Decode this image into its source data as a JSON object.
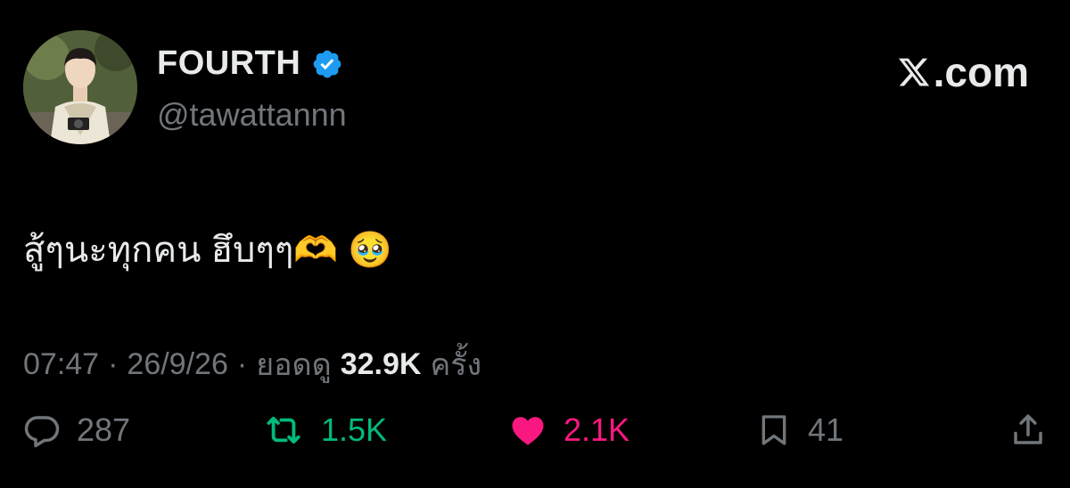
{
  "author": {
    "name": "FOURTH",
    "handle": "@tawattannn",
    "verified": true,
    "verified_color": "#1d9bf0"
  },
  "brand": {
    "label": ".com"
  },
  "tweet": {
    "text": "สู้ๆนะทุกคน ฮึบๆๆ🫶 🥹"
  },
  "meta": {
    "time": "07:47",
    "separator": "·",
    "date": "26/9/26",
    "views_prefix": "ยอดดู",
    "views": "32.9K",
    "views_suffix": "ครั้ง"
  },
  "actions": {
    "reply_count": "287",
    "retweet_count": "1.5K",
    "like_count": "2.1K",
    "bookmark_count": "41"
  },
  "colors": {
    "background": "#000000",
    "text": "#e7e9ea",
    "secondary": "#71767b",
    "retweet": "#00ba7c",
    "like": "#f91880"
  }
}
